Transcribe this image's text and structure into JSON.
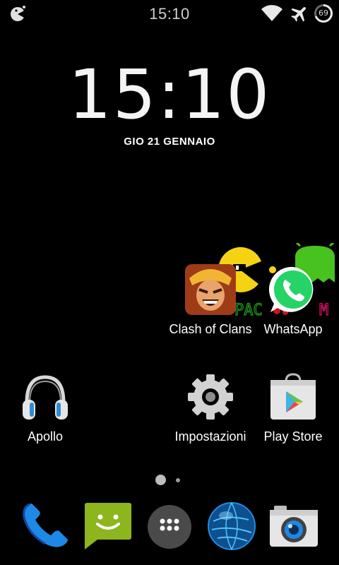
{
  "status_bar": {
    "time": "15:10",
    "battery_level": "69",
    "icons": [
      "notification-icon",
      "wifi-icon",
      "airplane-mode-icon",
      "battery-icon"
    ]
  },
  "clock_widget": {
    "time": "15:10",
    "date": "GIO 21 GENNAIO"
  },
  "home_apps": [
    {
      "label": "Clash of Clans",
      "icon": "clash-of-clans-icon"
    },
    {
      "label": "WhatsApp",
      "icon": "whatsapp-icon"
    },
    {
      "label": "Apollo",
      "icon": "headphones-icon"
    },
    {
      "label": "Impostazioni",
      "icon": "settings-gear-icon"
    },
    {
      "label": "Play Store",
      "icon": "play-store-icon"
    }
  ],
  "page_indicator": {
    "current_page": 1,
    "total_pages": 2
  },
  "dock": [
    {
      "icon": "phone-icon"
    },
    {
      "icon": "messaging-icon"
    },
    {
      "icon": "app-drawer-icon"
    },
    {
      "icon": "browser-globe-icon"
    },
    {
      "icon": "camera-icon"
    }
  ],
  "colors": {
    "background": "#000000",
    "whatsapp_green": "#25D366",
    "phone_blue": "#1565C0",
    "messaging_green": "#8DB51E"
  }
}
